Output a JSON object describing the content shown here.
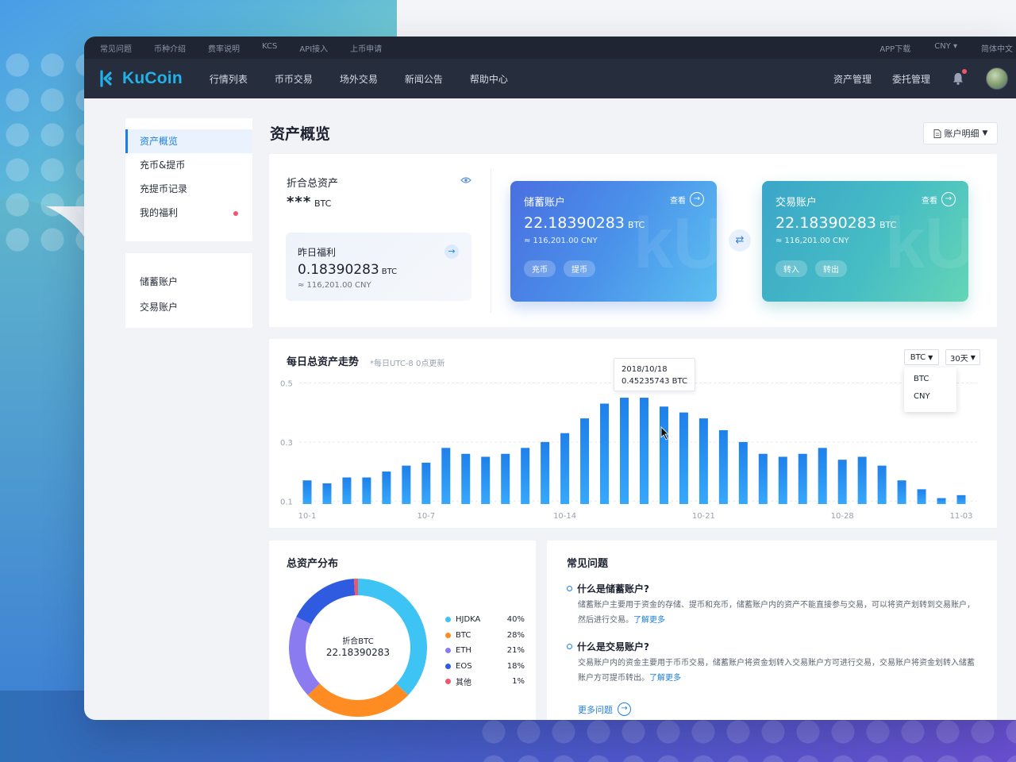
{
  "topbar": {
    "left": [
      "常见问题",
      "币种介绍",
      "费率说明",
      "KCS",
      "API接入",
      "上币申请"
    ],
    "app": "APP下载",
    "currency": "CNY ▾",
    "lang": "简体中文"
  },
  "nav": {
    "logo": "KuCoin",
    "menu": [
      "行情列表",
      "币币交易",
      "场外交易",
      "新闻公告",
      "帮助中心"
    ],
    "assets": "资产管理",
    "orders": "委托管理"
  },
  "sidebar": {
    "group1": [
      "资产概览",
      "充币&提币",
      "充提币记录",
      "我的福利"
    ],
    "group2": [
      "储蓄账户",
      "交易账户"
    ]
  },
  "page": {
    "title": "资产概览",
    "detail_btn": "账户明细"
  },
  "overview": {
    "total_label": "折合总资产",
    "total_value": "***",
    "total_unit": "BTC",
    "welfare": {
      "label": "昨日福利",
      "value": "0.18390283",
      "unit": "BTC",
      "cny": "≈ 116,201.00 CNY"
    },
    "savings": {
      "title": "储蓄账户",
      "view": "查看",
      "value": "22.18390283",
      "unit": "BTC",
      "cny": "≈ 116,201.00 CNY",
      "btn1": "充币",
      "btn2": "提币"
    },
    "trading": {
      "title": "交易账户",
      "view": "查看",
      "value": "22.18390283",
      "unit": "BTC",
      "cny": "≈ 116,201.00 CNY",
      "btn1": "转入",
      "btn2": "转出"
    }
  },
  "trend": {
    "title": "每日总资产走势",
    "note": "*每日UTC-8 0点更新",
    "currency_select": "BTC",
    "period_select": "30天",
    "dropdown": [
      "BTC",
      "CNY"
    ],
    "tooltip_date": "2018/10/18",
    "tooltip_value": "0.45235743 BTC"
  },
  "chart_data": {
    "type": "bar",
    "categories": [
      "10-1",
      "10-2",
      "10-3",
      "10-4",
      "10-5",
      "10-6",
      "10-7",
      "10-8",
      "10-9",
      "10-10",
      "10-11",
      "10-12",
      "10-13",
      "10-14",
      "10-15",
      "10-16",
      "10-17",
      "10-18",
      "10-19",
      "10-20",
      "10-21",
      "10-22",
      "10-23",
      "10-24",
      "10-25",
      "10-26",
      "10-27",
      "10-28",
      "10-29",
      "10-30",
      "10-31",
      "11-01",
      "11-02",
      "11-03"
    ],
    "x_tick_labels": [
      "10-1",
      "10-7",
      "10-14",
      "10-21",
      "10-28",
      "11-03"
    ],
    "values": [
      0.17,
      0.16,
      0.18,
      0.18,
      0.2,
      0.22,
      0.23,
      0.28,
      0.26,
      0.25,
      0.26,
      0.28,
      0.3,
      0.33,
      0.38,
      0.43,
      0.45,
      0.45,
      0.42,
      0.4,
      0.38,
      0.34,
      0.3,
      0.26,
      0.25,
      0.26,
      0.28,
      0.24,
      0.25,
      0.22,
      0.17,
      0.14,
      0.11,
      0.12
    ],
    "y_ticks": [
      0.1,
      0.3,
      0.5
    ],
    "ylim": [
      0.09,
      0.52
    ],
    "color": "#1e88f0",
    "grid": true
  },
  "distribution": {
    "title": "总资产分布",
    "center_label": "折合BTC",
    "center_value": "22.18390283",
    "items": [
      {
        "name": "HJDKA",
        "pct": "40%",
        "value": 40,
        "color": "#3ec3f5"
      },
      {
        "name": "BTC",
        "pct": "28%",
        "value": 28,
        "color": "#ff8c23"
      },
      {
        "name": "ETH",
        "pct": "21%",
        "value": 21,
        "color": "#8a7cf0"
      },
      {
        "name": "EOS",
        "pct": "18%",
        "value": 18,
        "color": "#2f5be0"
      },
      {
        "name": "其他",
        "pct": "1%",
        "value": 1,
        "color": "#f0566b"
      }
    ]
  },
  "faq": {
    "title": "常见问题",
    "q1": "什么是储蓄账户?",
    "a1": "储蓄账户主要用于资金的存储、提币和充币，储蓄账户内的资产不能直接参与交易，可以将资产划转到交易账户，然后进行交易。",
    "link1": "了解更多",
    "q2": "什么是交易账户?",
    "a2": "交易账户内的资金主要用于币币交易，储蓄账户将资金划转入交易账户方可进行交易，交易账户将资金划转入储蓄账户方可提币转出。",
    "link2": "了解更多",
    "more": "更多问题"
  }
}
